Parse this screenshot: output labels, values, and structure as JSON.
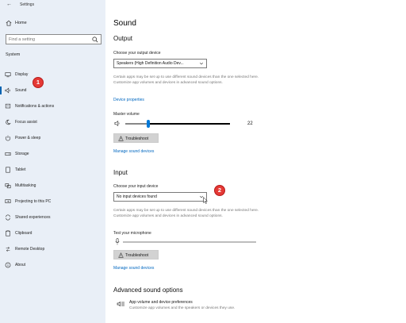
{
  "window": {
    "title": "Settings"
  },
  "sidebar": {
    "home_label": "Home",
    "search_placeholder": "Find a setting",
    "section_title": "System",
    "items": [
      {
        "label": "Display",
        "icon": "display-icon"
      },
      {
        "label": "Sound",
        "icon": "speaker-icon",
        "active": true
      },
      {
        "label": "Notifications & actions",
        "icon": "notification-icon"
      },
      {
        "label": "Focus assist",
        "icon": "moon-icon"
      },
      {
        "label": "Power & sleep",
        "icon": "power-icon"
      },
      {
        "label": "Storage",
        "icon": "storage-icon"
      },
      {
        "label": "Tablet",
        "icon": "tablet-icon"
      },
      {
        "label": "Multitasking",
        "icon": "multitasking-icon"
      },
      {
        "label": "Projecting to this PC",
        "icon": "projecting-icon"
      },
      {
        "label": "Shared experiences",
        "icon": "shared-icon"
      },
      {
        "label": "Clipboard",
        "icon": "clipboard-icon"
      },
      {
        "label": "Remote Desktop",
        "icon": "remote-desktop-icon"
      },
      {
        "label": "About",
        "icon": "info-icon"
      }
    ]
  },
  "main": {
    "title": "Sound",
    "output": {
      "heading": "Output",
      "device_label": "Choose your output device",
      "device_value": "Speakers (High Definition Audio Dev...",
      "description": "Certain apps may be set up to use different sound devices than the one selected here. Customize app volumes and devices in advanced sound options.",
      "properties_link": "Device properties",
      "volume_label": "Master volume",
      "volume_value": "22",
      "volume_fraction": 0.22,
      "troubleshoot_label": "Troubleshoot",
      "manage_link": "Manage sound devices"
    },
    "input": {
      "heading": "Input",
      "device_label": "Choose your input device",
      "device_value": "No input devices found",
      "description": "Certain apps may be set up to use different sound devices than the one selected here. Customize app volumes and devices in advanced sound options.",
      "test_label": "Test your microphone",
      "troubleshoot_label": "Troubleshoot",
      "manage_link": "Manage sound devices"
    },
    "advanced": {
      "heading": "Advanced sound options",
      "item_title": "App volume and device preferences",
      "item_desc": "Customize app volumes and the speakers or devices they use."
    }
  },
  "annotations": {
    "badge1": "1",
    "badge2": "2",
    "color": "#e53935"
  },
  "colors": {
    "accent": "#0078d7",
    "link": "#0067c0",
    "sidebar_bg": "#e9eff7"
  }
}
